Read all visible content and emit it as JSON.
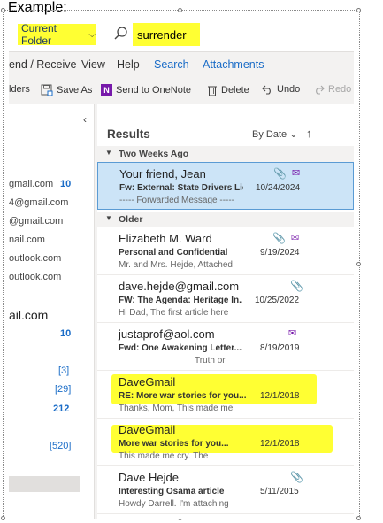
{
  "caption": "Example:",
  "search": {
    "scope_label": "Current Folder",
    "query": "surrender"
  },
  "tabs": [
    "end / Receive",
    "View",
    "Help",
    "Search",
    "Attachments"
  ],
  "commands": {
    "folders": "lders",
    "save_as": "Save As",
    "send_onenote": "Send to OneNote",
    "delete": "Delete",
    "undo": "Undo",
    "redo": "Redo"
  },
  "folder_pane": {
    "accounts": [
      "gmail.com",
      "4@gmail.com",
      "@gmail.com",
      "nail.com",
      "outlook.com",
      "outlook.com"
    ],
    "first_count": "10",
    "big_account": "ail.com",
    "big_count": "10",
    "folder_counts": [
      "[3]",
      "[29]",
      "212",
      "[520]"
    ]
  },
  "list": {
    "title": "Results",
    "sort_label": "By Date",
    "groups": [
      "Two Weeks Ago",
      "Older"
    ],
    "items": [
      {
        "sender": "Your friend, Jean",
        "subject": "Fw: External: State Drivers Lic...",
        "date": "10/24/2024",
        "preview": "----- Forwarded Message -----"
      },
      {
        "sender": "Elizabeth M. Ward",
        "subject": "Personal and Confidential",
        "date": "9/19/2024",
        "preview": "Mr. and Mrs. Hejde,   Attached"
      },
      {
        "sender": "dave.hejde@gmail.com",
        "subject": "FW: The Agenda: Heritage In...",
        "date": "10/25/2022",
        "preview": "Hi Dad, The first article here"
      },
      {
        "sender": "justaprof@aol.com",
        "subject": "Fwd: One Awakening Letter....",
        "date": "8/19/2019",
        "preview": "Truth or"
      },
      {
        "sender": "DaveGmail",
        "subject": "RE: More war stories for you...",
        "date": "12/1/2018",
        "preview": "Thanks, Mom,  This made me"
      },
      {
        "sender": "DaveGmail",
        "subject": "More war stories for you...",
        "date": "12/1/2018",
        "preview": "This made me cry.  The"
      },
      {
        "sender": "Dave Hejde",
        "subject": "Interesting Osama article",
        "date": "5/11/2015",
        "preview": "Howdy Darrell.  I'm attaching"
      }
    ]
  },
  "colors": {
    "highlight": "#ffff33",
    "link_blue": "#1a6cc7",
    "selected_bg": "#cce4f7"
  }
}
